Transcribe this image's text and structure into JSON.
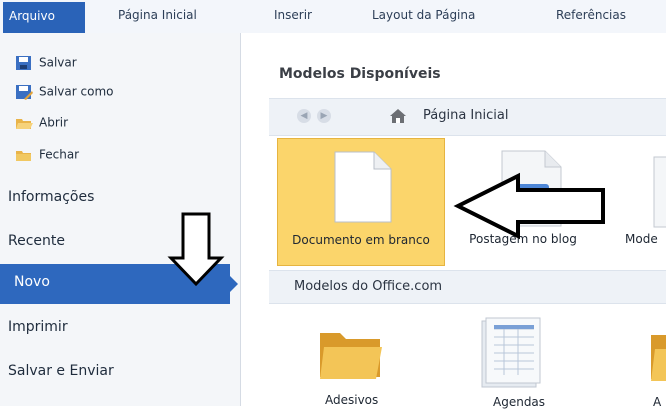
{
  "ribbon": {
    "tabs": [
      {
        "label": "Arquivo",
        "active": true
      },
      {
        "label": "Página Inicial"
      },
      {
        "label": "Inserir"
      },
      {
        "label": "Layout da Página"
      },
      {
        "label": "Referências"
      }
    ]
  },
  "left_panel": {
    "quick_items": [
      {
        "label": "Salvar",
        "icon": "save-icon"
      },
      {
        "label": "Salvar como",
        "icon": "save-as-icon"
      },
      {
        "label": "Abrir",
        "icon": "open-folder-icon"
      },
      {
        "label": "Fechar",
        "icon": "close-folder-icon"
      }
    ],
    "nav_items": [
      {
        "label": "Informações"
      },
      {
        "label": "Recente"
      },
      {
        "label": "Novo",
        "active": true
      },
      {
        "label": "Imprimir"
      },
      {
        "label": "Salvar e Enviar"
      }
    ]
  },
  "main": {
    "available_title": "Modelos Disponíveis",
    "navbar": {
      "home_label": "Página Inicial"
    },
    "templates": [
      {
        "label": "Documento em branco",
        "selected": true
      },
      {
        "label": "Postagem no blog"
      },
      {
        "label": "Mode"
      }
    ],
    "office_title": "Modelos do Office.com",
    "office_templates": [
      {
        "label": "Adesivos"
      },
      {
        "label": "Agendas"
      },
      {
        "label": "A"
      }
    ]
  },
  "colors": {
    "accent": "#2e68be",
    "selected_tile": "#fbd56b"
  }
}
